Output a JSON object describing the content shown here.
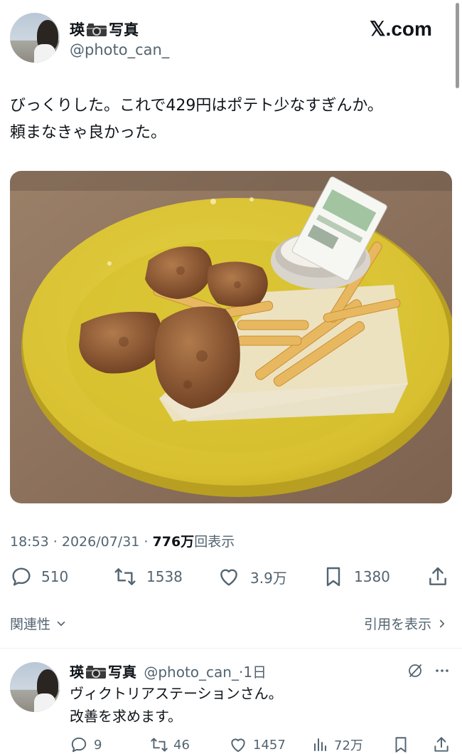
{
  "brand": {
    "logo": "𝕏.com"
  },
  "author": {
    "name_prefix": "瑛",
    "name_suffix": "写真",
    "handle": "@photo_can_"
  },
  "tweet": {
    "text_line1": "びっくりした。これで429円はポテト少なすぎんか。",
    "text_line2": "頼まなきゃ良かった。",
    "timestamp": "18:53 · 2026/07/31 · ",
    "views_count": "776万",
    "views_label": "回表示",
    "replies": "510",
    "retweets": "1538",
    "likes": "3.9万",
    "bookmarks": "1380"
  },
  "filter": {
    "sort_label": "関連性",
    "quotes_label": "引用を表示"
  },
  "reply": {
    "name_prefix": "瑛",
    "name_suffix": "写真",
    "handle_time": "@photo_can_·1日",
    "text_line1": "ヴィクトリアステーションさん。",
    "text_line2": "改善を求めます。",
    "replies": "9",
    "retweets": "46",
    "likes": "1457",
    "views": "72万"
  },
  "icons": [
    "camera-icon",
    "reply-icon",
    "retweet-icon",
    "like-icon",
    "bookmark-icon",
    "share-icon",
    "chevron-down-icon",
    "chevron-right-icon",
    "grok-icon",
    "more-icon",
    "views-icon"
  ]
}
